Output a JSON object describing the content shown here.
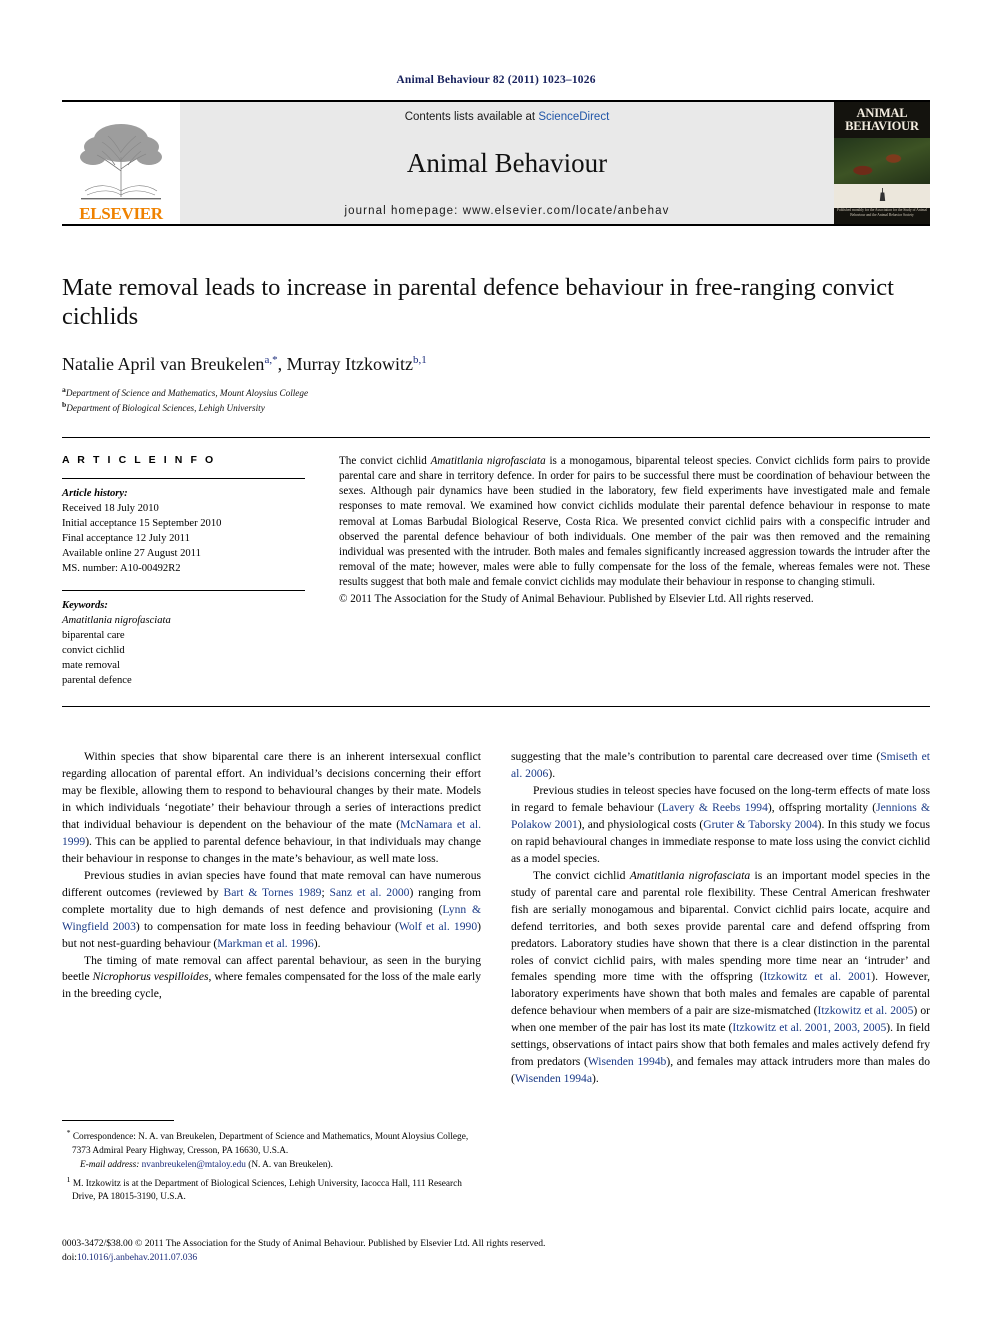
{
  "running_head": "Animal Behaviour 82 (2011) 1023–1026",
  "masthead": {
    "publisher_name": "ELSEVIER",
    "publisher_logo": "elsevier-tree-logo",
    "contents_text": "Contents lists available at ",
    "sciencedirect": "ScienceDirect",
    "journal_title": "Animal Behaviour",
    "homepage_label": "journal homepage: www.elsevier.com/locate/anbehav",
    "cover": {
      "line1": "ANIMAL",
      "line2": "BEHAVIOUR",
      "footer": "Published monthly for the Association for the Study of Animal Behaviour and the Animal Behavior Society"
    }
  },
  "article": {
    "title": "Mate removal leads to increase in parental defence behaviour in free-ranging convict cichlids",
    "authors": "Natalie April van Breukelen",
    "author_marks_1": "a,*",
    "author2": ", Murray Itzkowitz",
    "author_marks_2": "b,1",
    "affiliation_a_mark": "a",
    "affiliation_a": "Department of Science and Mathematics, Mount Aloysius College",
    "affiliation_b_mark": "b",
    "affiliation_b": "Department of Biological Sciences, Lehigh University"
  },
  "info": {
    "heading": "A R T I C L E  I N F O",
    "history_label": "Article history:",
    "history": [
      "Received 18 July 2010",
      "Initial acceptance 15 September 2010",
      "Final acceptance 12 July 2011",
      "Available online 27 August 2011",
      "MS. number: A10-00492R2"
    ],
    "keywords_label": "Keywords:",
    "keywords": [
      "Amatitlania nigrofasciata",
      "biparental care",
      "convict cichlid",
      "mate removal",
      "parental defence"
    ]
  },
  "abstract": {
    "p1_a": "The convict cichlid ",
    "p1_species": "Amatitlania nigrofasciata",
    "p1_b": " is a monogamous, biparental teleost species. Convict cichlids form pairs to provide parental care and share in territory defence. In order for pairs to be successful there must be coordination of behaviour between the sexes. Although pair dynamics have been studied in the laboratory, few field experiments have investigated male and female responses to mate removal. We examined how convict cichlids modulate their parental defence behaviour in response to mate removal at Lomas Barbudal Biological Reserve, Costa Rica. We presented convict cichlid pairs with a conspecific intruder and observed the parental defence behaviour of both individuals. One member of the pair was then removed and the remaining individual was presented with the intruder. Both males and females significantly increased aggression towards the intruder after the removal of the mate; however, males were able to fully compensate for the loss of the female, whereas females were not. These results suggest that both male and female convict cichlids may modulate their behaviour in response to changing stimuli.",
    "copyright": "© 2011 The Association for the Study of Animal Behaviour. Published by Elsevier Ltd. All rights reserved."
  },
  "body": {
    "left": {
      "p1_a": "Within species that show biparental care there is an inherent intersexual conflict regarding allocation of parental effort. An individual’s decisions concerning their effort may be flexible, allowing them to respond to behavioural changes by their mate. Models in which individuals ‘negotiate’ their behaviour through a series of interactions predict that individual behaviour is dependent on the behaviour of the mate (",
      "p1_cite1": "McNamara et al. 1999",
      "p1_b": "). This can be applied to parental defence behaviour, in that individuals may change their behaviour in response to changes in the mate’s behaviour, as well mate loss.",
      "p2_a": "Previous studies in avian species have found that mate removal can have numerous different outcomes (reviewed by ",
      "p2_cite1": "Bart & Tornes 1989",
      "p2_b": "; ",
      "p2_cite2": "Sanz et al. 2000",
      "p2_c": ") ranging from complete mortality due to high demands of nest defence and provisioning (",
      "p2_cite3": "Lynn & Wingfield 2003",
      "p2_d": ") to compensation for mate loss in feeding behaviour (",
      "p2_cite4": "Wolf et al. 1990",
      "p2_e": ") but not nest-guarding behaviour (",
      "p2_cite5": "Markman et al. 1996",
      "p2_f": ").",
      "p3_a": "The timing of mate removal can affect parental behaviour, as seen in the burying beetle ",
      "p3_species": "Nicrophorus vespilloides",
      "p3_b": ", where females compensated for the loss of the male early in the breeding cycle,"
    },
    "right": {
      "p1_a": "suggesting that the male’s contribution to parental care decreased over time (",
      "p1_cite1": "Smiseth et al. 2006",
      "p1_b": ").",
      "p2_a": "Previous studies in teleost species have focused on the long-term effects of mate loss in regard to female behaviour (",
      "p2_cite1": "Lavery & Reebs 1994",
      "p2_b": "), offspring mortality (",
      "p2_cite2": "Jennions & Polakow 2001",
      "p2_c": "), and physiological costs (",
      "p2_cite3": "Gruter & Taborsky 2004",
      "p2_d": "). In this study we focus on rapid behavioural changes in immediate response to mate loss using the convict cichlid as a model species.",
      "p3_a": "The convict cichlid ",
      "p3_species": "Amatitlania nigrofasciata",
      "p3_b": " is an important model species in the study of parental care and parental role flexibility. These Central American freshwater fish are serially monogamous and biparental. Convict cichlid pairs locate, acquire and defend territories, and both sexes provide parental care and defend offspring from predators. Laboratory studies have shown that there is a clear distinction in the parental roles of convict cichlid pairs, with males spending more time near an ‘intruder’ and females spending more time with the offspring (",
      "p3_cite1": "Itzkowitz et al. 2001",
      "p3_c": "). However, laboratory experiments have shown that both males and females are capable of parental defence behaviour when members of a pair are size-mismatched (",
      "p3_cite2": "Itzkowitz et al. 2005",
      "p3_d": ") or when one member of the pair has lost its mate (",
      "p3_cite3": "Itzkowitz et al. 2001, 2003, 2005",
      "p3_e": "). In field settings, observations of intact pairs show that both females and males actively defend fry from predators (",
      "p3_cite4": "Wisenden 1994b",
      "p3_f": "), and females may attack intruders more than males do (",
      "p3_cite5": "Wisenden 1994a",
      "p3_g": ")."
    }
  },
  "footnotes": {
    "correspondence_mark": "*",
    "correspondence": "Correspondence: N. A. van Breukelen, Department of Science and Mathematics, Mount Aloysius College, 7373 Admiral Peary Highway, Cresson, PA 16630, U.S.A.",
    "email_label": "E-mail address:",
    "email": "nvanbreukelen@mtaloy.edu",
    "email_owner": "(N. A. van Breukelen).",
    "note1_mark": "1",
    "note1": "M. Itzkowitz is at the Department of Biological Sciences, Lehigh University, Iacocca Hall, 111 Research Drive, PA 18015-3190, U.S.A."
  },
  "imprint": {
    "issn_line": "0003-3472/$38.00 © 2011 The Association for the Study of Animal Behaviour. Published by Elsevier Ltd. All rights reserved.",
    "doi_label": "doi:",
    "doi": "10.1016/j.anbehav.2011.07.036"
  },
  "colors": {
    "link": "#1a2b7a",
    "citation": "#1a3a86",
    "elsevier_orange": "#ef8200",
    "banner_bg": "#e9e9e9"
  }
}
